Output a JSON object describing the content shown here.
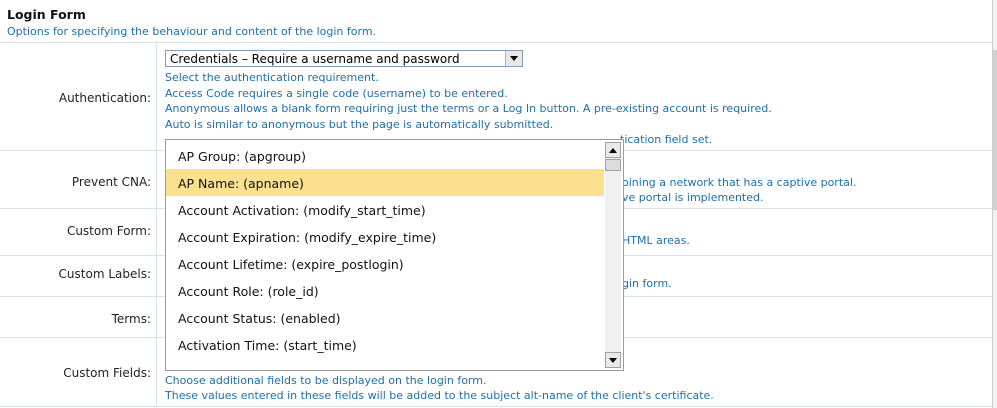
{
  "section": {
    "title": "Login Form",
    "description": "Options for specifying the behaviour and content of the login form."
  },
  "authentication": {
    "label": "Authentication:",
    "selected": "Credentials – Require a username and password",
    "help": [
      "Select the authentication requirement.",
      "Access Code requires a single code (username) to be entered.",
      "Anonymous allows a blank form requiring just the terms or a Log In button. A pre-existing account is required.",
      "Auto is similar to anonymous but the page is automatically submitted.",
      "tication field set."
    ]
  },
  "prevent_cna": {
    "label": "Prevent CNA:",
    "help": [
      "oining a network that has a captive portal.",
      "ve portal is implemented."
    ]
  },
  "custom_form": {
    "label": "Custom Form:",
    "help": "HTML areas."
  },
  "custom_labels": {
    "label": "Custom Labels:",
    "help": "gin form."
  },
  "terms": {
    "label": "Terms:"
  },
  "custom_fields": {
    "label": "Custom Fields:",
    "help": [
      "Choose additional fields to be displayed on the login form.",
      "These values entered in these fields will be added to the subject alt-name of the client's certificate."
    ]
  },
  "dropdown": {
    "highlight_color": "#fbe08f",
    "options": [
      "AP Group: (apgroup)",
      "AP Name: (apname)",
      "Account Activation: (modify_start_time)",
      "Account Expiration: (modify_expire_time)",
      "Account Lifetime: (expire_postlogin)",
      "Account Role: (role_id)",
      "Account Status: (enabled)",
      "Activation Time: (start_time)"
    ],
    "highlighted_index": 1
  }
}
